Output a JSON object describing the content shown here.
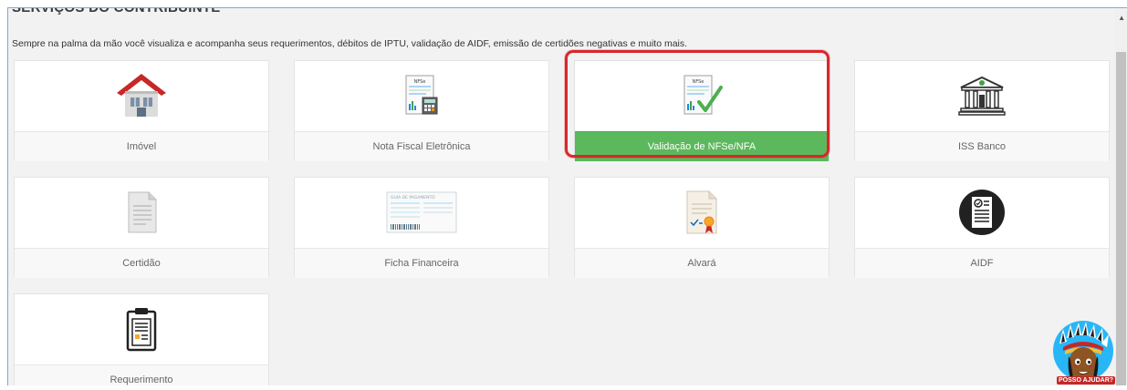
{
  "page": {
    "title": "SERVIÇOS DO CONTRIBUINTE",
    "intro": "Sempre na palma da mão você visualiza e acompanha seus requerimentos, débitos de IPTU, validação de AIDF, emissão de certidões negativas e muito mais."
  },
  "cards": [
    {
      "label": "Imóvel",
      "icon": "house-icon"
    },
    {
      "label": "Nota Fiscal Eletrônica",
      "icon": "nfse-calculator-icon"
    },
    {
      "label": "Validação de NFSe/NFA",
      "icon": "nfse-check-icon",
      "active": true
    },
    {
      "label": "ISS Banco",
      "icon": "bank-icon"
    },
    {
      "label": "Certidão",
      "icon": "document-icon"
    },
    {
      "label": "Ficha Financeira",
      "icon": "payment-slip-icon"
    },
    {
      "label": "Alvará",
      "icon": "license-icon"
    },
    {
      "label": "AIDF",
      "icon": "certificate-icon"
    },
    {
      "label": "Requerimento",
      "icon": "clipboard-icon"
    }
  ],
  "icon_text": {
    "nfse": "NFSe",
    "slip": "GUIA DE PAGAMENTO"
  },
  "help": {
    "label": "POSSO AJUDAR?"
  },
  "colors": {
    "active": "#5cb85c",
    "highlight": "#d9262b",
    "frame_border": "#7aa7dd"
  }
}
